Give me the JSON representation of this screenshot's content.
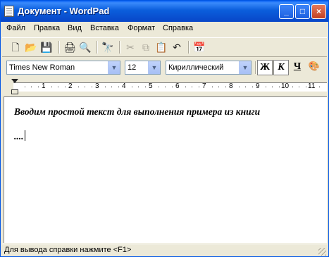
{
  "window": {
    "title": "Документ - WordPad",
    "app_icon": "wordpad-document-icon",
    "controls": {
      "minimize": "_",
      "maximize": "□",
      "close": "×"
    }
  },
  "menubar": {
    "items": [
      {
        "label": "Файл"
      },
      {
        "label": "Правка"
      },
      {
        "label": "Вид"
      },
      {
        "label": "Вставка"
      },
      {
        "label": "Формат"
      },
      {
        "label": "Справка"
      }
    ]
  },
  "toolbar": {
    "items": [
      {
        "icon": "new-document-icon",
        "glyph": "🗋",
        "enabled": true
      },
      {
        "icon": "open-folder-icon",
        "glyph": "📂",
        "enabled": true
      },
      {
        "icon": "save-icon",
        "glyph": "💾",
        "enabled": true
      },
      {
        "icon": "print-icon",
        "glyph": "🖨",
        "enabled": true
      },
      {
        "icon": "print-preview-icon",
        "glyph": "🔍",
        "enabled": true
      },
      {
        "icon": "find-icon",
        "glyph": "🔭",
        "enabled": true
      },
      {
        "icon": "cut-icon",
        "glyph": "✂",
        "enabled": false
      },
      {
        "icon": "copy-icon",
        "glyph": "⧉",
        "enabled": false
      },
      {
        "icon": "paste-icon",
        "glyph": "📋",
        "enabled": true
      },
      {
        "icon": "undo-icon",
        "glyph": "↶",
        "enabled": true
      },
      {
        "icon": "insert-datetime-icon",
        "glyph": "📅",
        "enabled": true
      }
    ]
  },
  "format_bar": {
    "font_name": "Times New Roman",
    "font_size": "12",
    "script": "Кириллический",
    "bold_label": "Ж",
    "italic_label": "К",
    "underline_label": "Ч",
    "italic_active": true,
    "bold_active": true,
    "color_icon": "color-palette-icon"
  },
  "ruler": {
    "numbers": [
      "1",
      "2",
      "3",
      "4",
      "5",
      "6",
      "7",
      "8",
      "9",
      "10",
      "11"
    ]
  },
  "document": {
    "lines": [
      "Вводим простой текст для выполнения примера из книги",
      "...."
    ]
  },
  "status_bar": {
    "text": "Для вывода справки нажмите <F1>"
  }
}
